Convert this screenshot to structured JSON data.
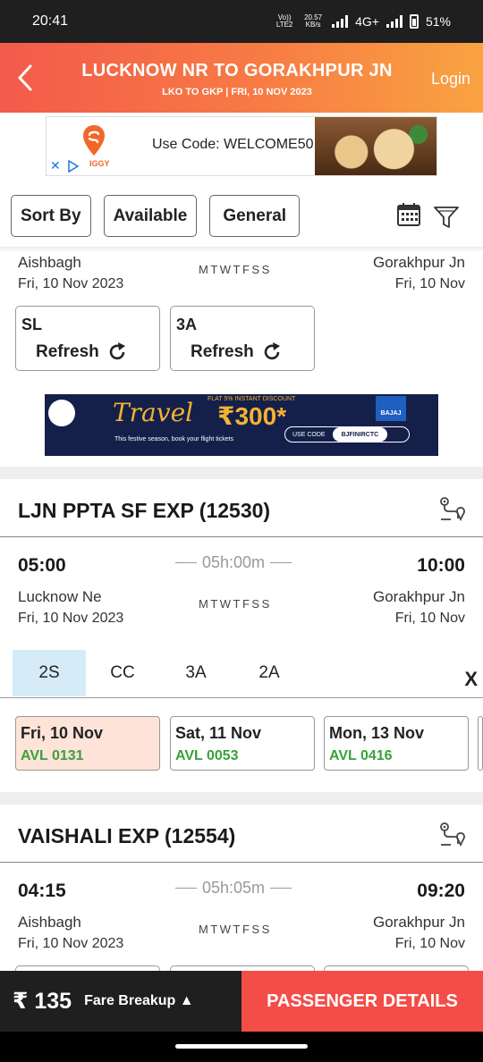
{
  "status_bar": {
    "time": "20:41",
    "volte": "Vo)) LTE2",
    "speed_value": "20.57",
    "speed_unit": "KB/s",
    "network": "4G+",
    "battery": "51%"
  },
  "header": {
    "title": "LUCKNOW NR TO GORAKHPUR JN",
    "subtitle": "LKO TO GKP | FRI, 10 NOV  2023",
    "login_label": "Login"
  },
  "promo_ad": {
    "brand_fragment": "IGGY",
    "code_text": "Use Code: WELCOME50"
  },
  "filters": {
    "sort_label": "Sort By",
    "available_label": "Available",
    "quota_label": "General"
  },
  "partial_train": {
    "from_station": "Aishbagh",
    "from_date": "Fri, 10 Nov  2023",
    "days": "MTWTFSS",
    "to_station": "Gorakhpur Jn",
    "to_date": "Fri, 10 Nov",
    "classes": [
      {
        "code": "SL",
        "action": "Refresh"
      },
      {
        "code": "3A",
        "action": "Refresh"
      }
    ]
  },
  "bajaj_ad": {
    "headline": "Travel",
    "offer_small": "FLAT 5% INSTANT DISCOUNT",
    "amount": "₹300*",
    "festive_text": "This festive season, book your flight tickets",
    "code_label": "USE CODE",
    "code_value": "BJFINIRCTC",
    "brand": "BAJAJ"
  },
  "trains": [
    {
      "name": "LJN PPTA SF EXP (12530)",
      "departure": "05:00",
      "duration": "05h:00m",
      "arrival": "10:00",
      "from_station": "Lucknow Ne",
      "from_date": "Fri, 10 Nov  2023",
      "days": "MTWTFSS",
      "to_station": "Gorakhpur Jn",
      "to_date": "Fri, 10 Nov",
      "class_tabs": [
        "2S",
        "CC",
        "3A",
        "2A"
      ],
      "close_label": "X",
      "dates": [
        {
          "date": "Fri, 10 Nov",
          "avl": "AVL 0131"
        },
        {
          "date": "Sat, 11 Nov",
          "avl": "AVL 0053"
        },
        {
          "date": "Mon, 13 Nov",
          "avl": "AVL 0416"
        }
      ]
    },
    {
      "name": "VAISHALI EXP (12554)",
      "departure": "04:15",
      "duration": "05h:05m",
      "arrival": "09:20",
      "from_station": "Aishbagh",
      "from_date": "Fri, 10 Nov  2023",
      "days": "MTWTFSS",
      "to_station": "Gorakhpur Jn",
      "to_date": "Fri, 10 Nov"
    }
  ],
  "bottom_bar": {
    "fare": "₹ 135",
    "fare_breakup_label": "Fare Breakup ▲",
    "passenger_button": "PASSENGER DETAILS"
  },
  "colors": {
    "header_start": "#f35a4b",
    "header_end": "#f9a341",
    "available_green": "#3aa13a",
    "selected_tab": "#d5ecf8",
    "selected_date": "#fde3d8",
    "cta_red": "#f44c47"
  }
}
